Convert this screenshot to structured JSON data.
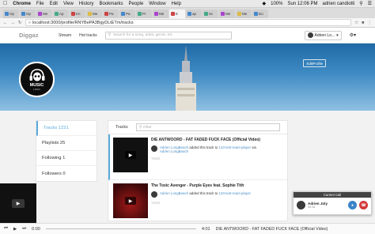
{
  "menubar": {
    "apple": "",
    "app": "Chrome",
    "items": [
      "File",
      "Edit",
      "View",
      "History",
      "Bookmarks",
      "People",
      "Window",
      "Help"
    ],
    "battery": "100%",
    "clock": "Sun 12:06 PM",
    "user": "adrien candiotti"
  },
  "tabs": [
    {
      "label": "Op",
      "color": "b"
    },
    {
      "label": "Op",
      "color": "b"
    },
    {
      "label": "Me",
      "color": "p"
    },
    {
      "label": "Ap",
      "color": "g"
    },
    {
      "label": "Kn",
      "color": ""
    },
    {
      "label": "Me",
      "color": "y"
    },
    {
      "label": "Pa",
      "color": ""
    },
    {
      "label": "Pa",
      "color": "b"
    },
    {
      "label": "Pr",
      "color": "g"
    },
    {
      "label": "Me",
      "color": "p"
    },
    {
      "label": "E",
      "color": ""
    },
    {
      "label": "ap",
      "color": "b"
    },
    {
      "label": "Sc",
      "color": "g"
    },
    {
      "label": "Me",
      "color": "p"
    },
    {
      "label": "Me",
      "color": "y"
    },
    {
      "label": "Do",
      "color": "b"
    }
  ],
  "address": {
    "url": "localhost:3000/profile/RNYBePA3BgyDLtETm/tracks"
  },
  "app": {
    "logo": "Diggaz",
    "nav": [
      "Stream",
      "Hot tracks"
    ],
    "search_placeholder": "Search for a song, artist, genre, etc",
    "user": "Adrien Lo..."
  },
  "profile": {
    "edit_label": "EditProfile",
    "logo_title": "MUSIC",
    "logo_sub": "LOGO"
  },
  "sidebar": {
    "stats": [
      "Tracks 1221",
      "Playlists 25",
      "Following 1",
      "Followers 0"
    ]
  },
  "feed": {
    "tab": "Tracks",
    "filter_placeholder": "Filter",
    "tracks": [
      {
        "title": "DIE ANTWOORD - FAT FADED FUCK FACE (Official Video)",
        "user": "Adrien LongBeach",
        "action": "added this track to",
        "playlist": "123-test-react-player",
        "via": "via",
        "via_user": "Adrien LongBeach",
        "edit": "Edit"
      },
      {
        "title": "The Toxic Avenger - Purple Eyes feat. Sophie Tith",
        "user": "Adrien LongBeach",
        "action": "added this track to",
        "playlist": "123-test-react-player",
        "edit": "Edit"
      }
    ]
  },
  "call": {
    "header": "Current Call",
    "name": "Adrien Joly",
    "time": "00:34"
  },
  "player": {
    "current": "0:00",
    "duration": "4:01",
    "now_playing": "DIE ANTWOORD - FAT FADED FUCK FACE (Official Video)",
    "progress": 0
  }
}
